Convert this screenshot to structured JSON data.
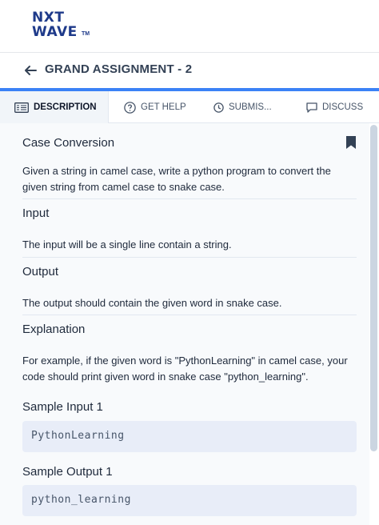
{
  "brand": {
    "line1": "NXT",
    "line2": "WAVE",
    "tm": "TM"
  },
  "header": {
    "title": "GRAND ASSIGNMENT - 2"
  },
  "tabs": [
    {
      "label": "DESCRIPTION",
      "icon": "document-icon",
      "active": true
    },
    {
      "label": "GET HELP",
      "icon": "help-icon",
      "active": false
    },
    {
      "label": "SUBMIS...",
      "icon": "clock-icon",
      "active": false
    },
    {
      "label": "DISCUSS",
      "icon": "chat-icon",
      "active": false
    }
  ],
  "problem": {
    "title": "Case Conversion",
    "description": "Given a string in camel case, write a python program to convert the given string from camel case to snake case.",
    "input_heading": "Input",
    "input_text": "The input will be a single line contain a string.",
    "output_heading": "Output",
    "output_text": "The output should contain the given word in snake case.",
    "explanation_heading": "Explanation",
    "explanation_text": "For example, if the given word is \"PythonLearning\" in camel case, your code should print given word in snake case \"python_learning\".",
    "sample_input_heading": "Sample Input 1",
    "sample_input": "PythonLearning",
    "sample_output_heading": "Sample Output 1",
    "sample_output": "python_learning"
  },
  "colors": {
    "accent": "#3b82f6",
    "brand": "#1e3a8a",
    "code_bg": "#e8edf8"
  }
}
